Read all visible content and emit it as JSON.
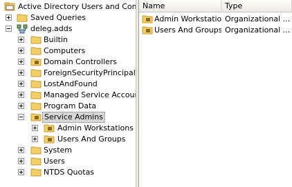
{
  "tree": {
    "root_label": "Active Directory Users and Comput",
    "saved_queries": "Saved Queries",
    "domain": "deleg.adds",
    "items": [
      {
        "label": "Builtin"
      },
      {
        "label": "Computers"
      },
      {
        "label": "Domain Controllers"
      },
      {
        "label": "ForeignSecurityPrincipals"
      },
      {
        "label": "LostAndFound"
      },
      {
        "label": "Managed Service Accounts"
      },
      {
        "label": "Program Data"
      },
      {
        "label": "Service Admins"
      },
      {
        "label": "Admin Workstations"
      },
      {
        "label": "Users And Groups"
      },
      {
        "label": "System"
      },
      {
        "label": "Users"
      },
      {
        "label": "NTDS Quotas"
      }
    ]
  },
  "list": {
    "columns": {
      "name": "Name",
      "type": "Type"
    },
    "rows": [
      {
        "name": "Admin Workstations",
        "type": "Organizational ..."
      },
      {
        "name": "Users And Groups",
        "type": "Organizational ..."
      }
    ]
  },
  "colors": {
    "folder": "#f2cf6b",
    "folder_dark": "#c99a2e",
    "ou_badge": "#8a6a1f",
    "selection": "#d7d7d7"
  },
  "icons": {
    "root": "ad-console-icon",
    "folder": "folder-icon",
    "ou": "ou-folder-icon",
    "domain": "domain-icon"
  }
}
